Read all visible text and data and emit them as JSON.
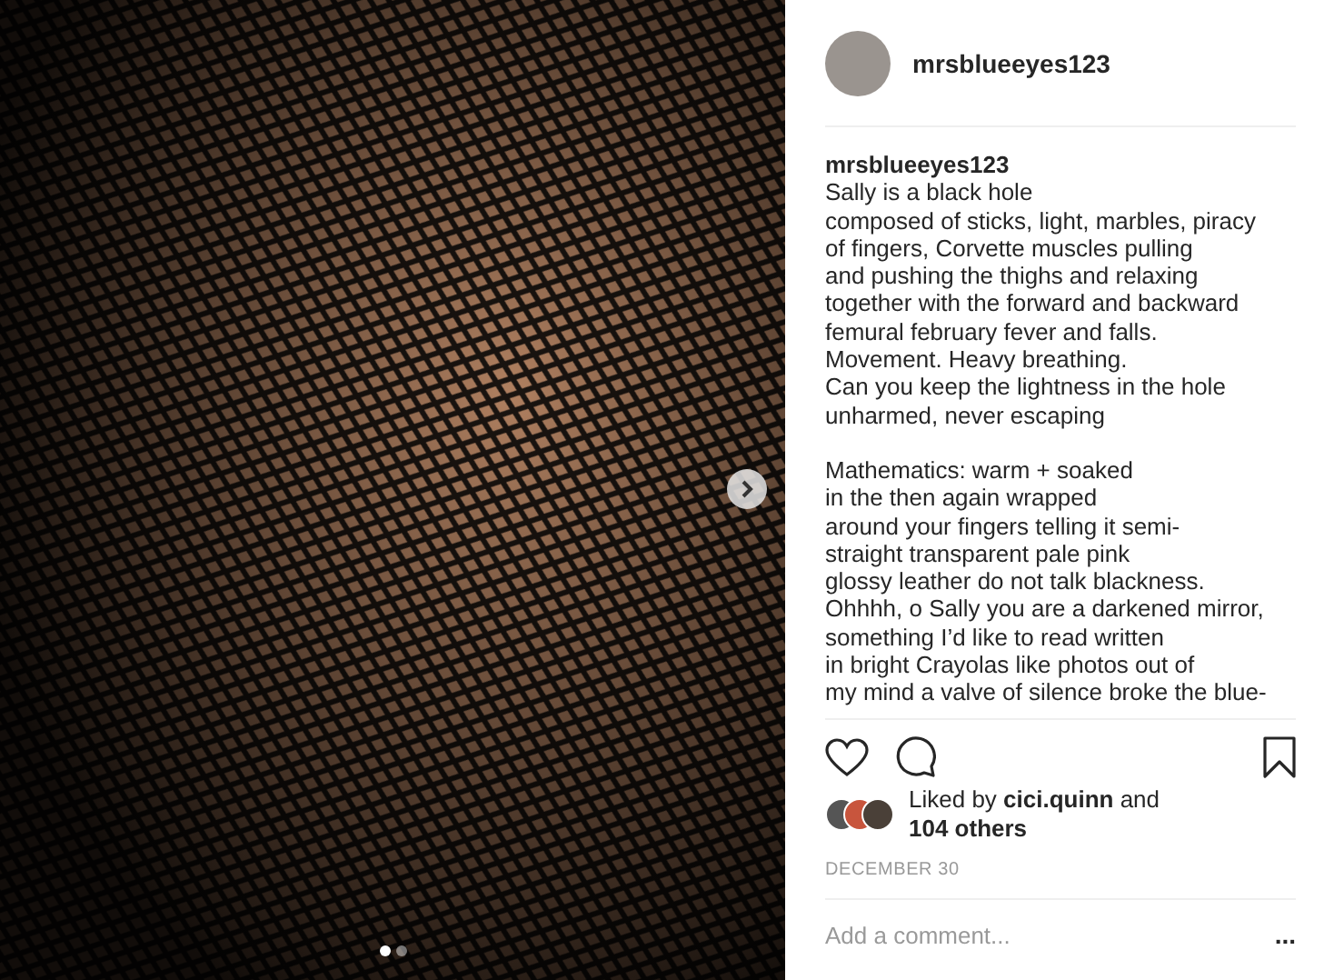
{
  "post": {
    "carousel_dots": [
      {
        "selected": true
      },
      {
        "selected": false
      }
    ]
  },
  "header": {
    "username": "mrsblueeyes123"
  },
  "caption": {
    "username": "mrsblueeyes123",
    "stanzas": [
      [
        "Sally is a black hole",
        "composed of sticks, light, marbles, piracy",
        "of fingers, Corvette muscles pulling",
        "and pushing the thighs and relaxing",
        "together with the forward and backward",
        "femural february fever and falls.",
        "Movement. Heavy breathing.",
        "Can you keep the lightness in the hole",
        "unharmed, never escaping"
      ],
      [
        "Mathematics: warm + soaked",
        "in the then again wrapped",
        "around your fingers telling it semi-",
        "straight transparent pale pink",
        "glossy leather do not talk blackness.",
        "Ohhhh, o Sally you are a darkened mirror,",
        "something I’d like to read written",
        "in bright Crayolas like photos out of",
        "my mind a valve of silence broke the blue-"
      ]
    ]
  },
  "likes": {
    "liked_by": "Liked by ",
    "user": "cici.quinn",
    "and": " and",
    "others": "104 others"
  },
  "date": "DECEMBER 30",
  "comment": {
    "placeholder": "Add a comment...",
    "more": "..."
  }
}
